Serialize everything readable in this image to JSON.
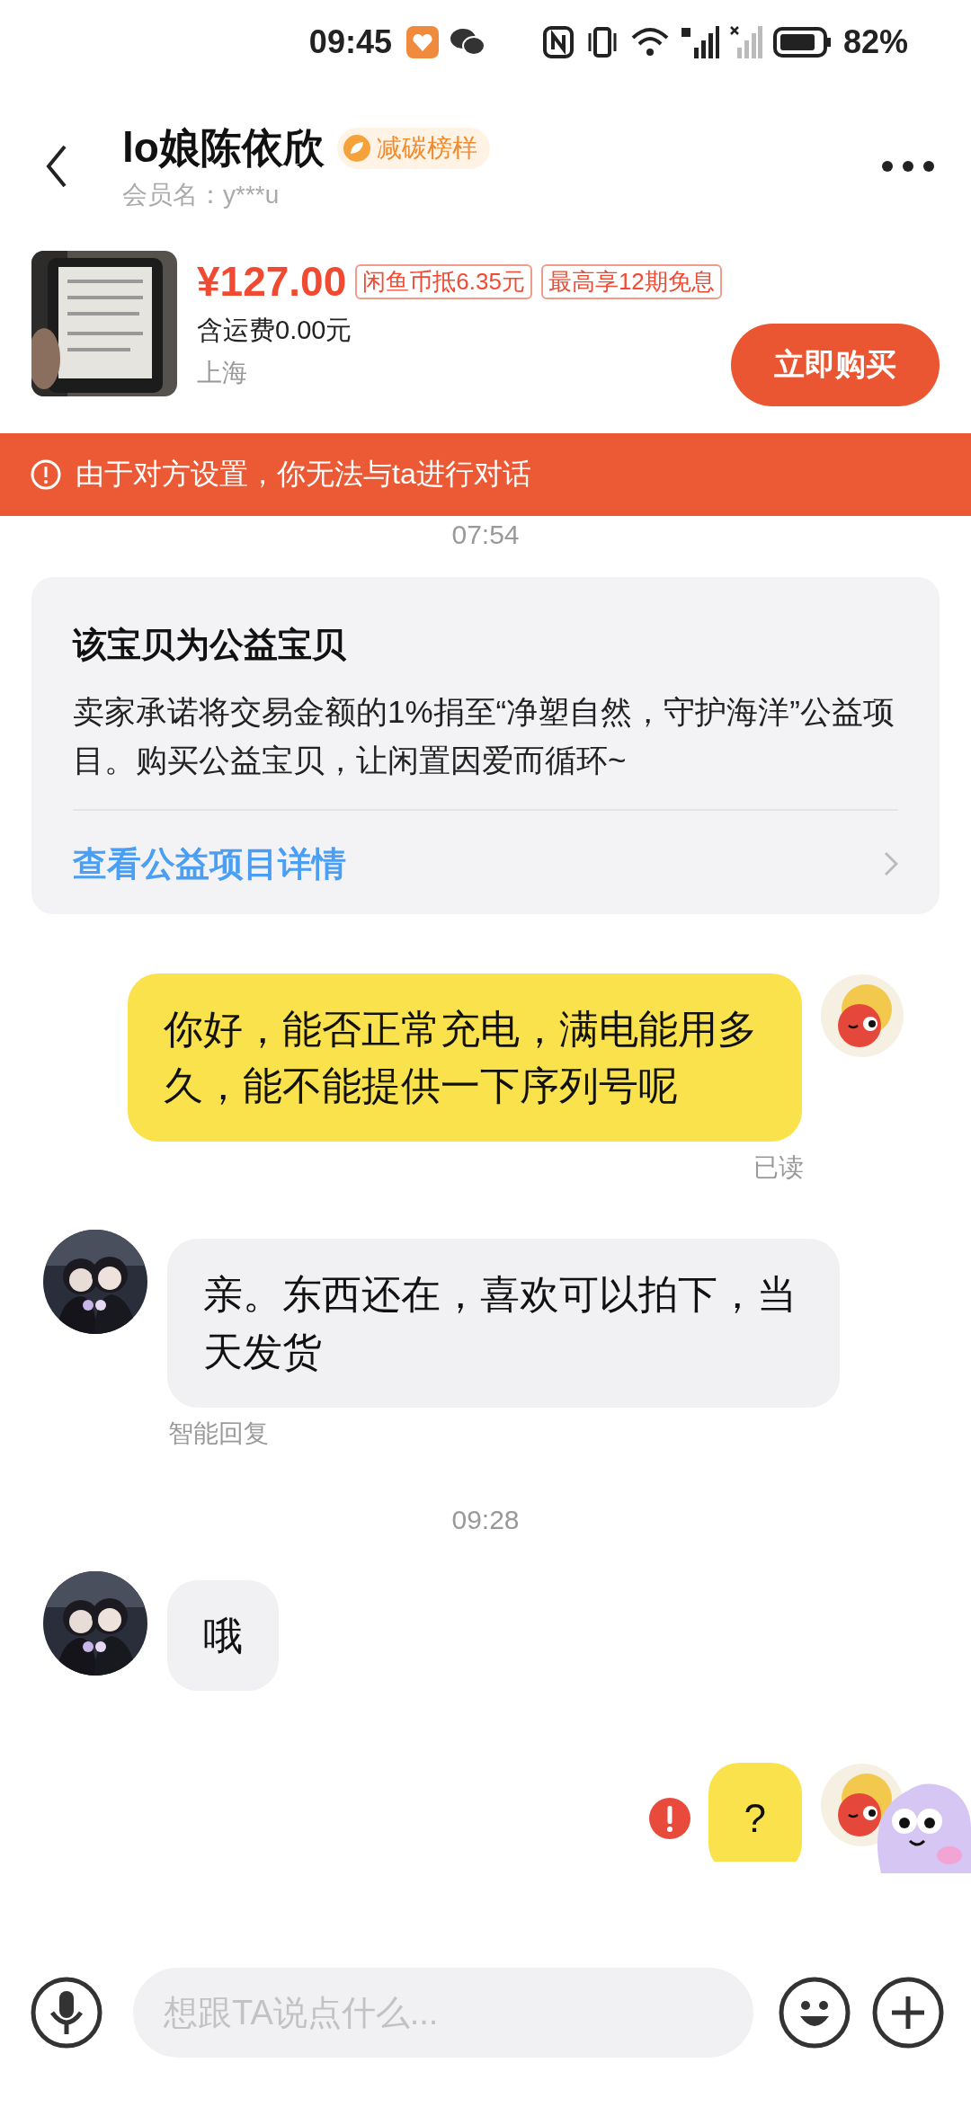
{
  "status_bar": {
    "time": "09:45",
    "battery": "82%"
  },
  "header": {
    "name": "lo娘陈依欣",
    "badge": "减碳榜样",
    "member": "会员名：y***u"
  },
  "product": {
    "price": "¥127.00",
    "tags": [
      "闲鱼币抵6.35元",
      "最高享12期免息"
    ],
    "shipping": "含运费0.00元",
    "location": "上海",
    "buy_button": "立即购买"
  },
  "notice": "由于对方设置，你无法与ta进行对话",
  "messages": [
    {
      "kind": "time",
      "text": "07:54"
    },
    {
      "kind": "card",
      "title": "该宝贝为公益宝贝",
      "body": "卖家承诺将交易金额的1%捐至“净塑自然，守护海洋”公益项目。购买公益宝贝，让闲置因爱而循环~",
      "link": "查看公益项目详情"
    },
    {
      "kind": "outgoing",
      "text": "你好，能否正常充电，满电能用多久，能不能提供一下序列号呢",
      "status": "已读",
      "failed": false
    },
    {
      "kind": "incoming",
      "text": "亲。东西还在，喜欢可以拍下，当天发货",
      "note": "智能回复"
    },
    {
      "kind": "time",
      "text": "09:28"
    },
    {
      "kind": "incoming",
      "text": "哦"
    },
    {
      "kind": "outgoing",
      "text": "?",
      "failed": true
    }
  ],
  "input": {
    "placeholder": "想跟TA说点什么..."
  }
}
